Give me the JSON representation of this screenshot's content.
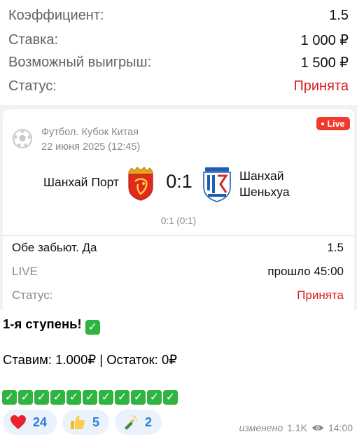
{
  "summary": {
    "rows": [
      {
        "label": "Коэффициент:",
        "value": "1.5"
      },
      {
        "label": "Ставка:",
        "value": "1 000 ₽"
      },
      {
        "label": "Возможный выигрыш:",
        "value": "1 500 ₽"
      },
      {
        "label": "Статус:",
        "value": "Принята"
      }
    ]
  },
  "match": {
    "league": "Футбол. Кубок Китая",
    "datetime": "22 июня 2025 (12:45)",
    "live_badge": "Live",
    "home_team": "Шанхай Порт",
    "away_team_line1": "Шанхай",
    "away_team_line2": "Шеньхуа",
    "score": "0:1",
    "halftime": "0:1 (0:1)",
    "bet_market": "Обе забьют. Да",
    "bet_odds": "1.5",
    "state_label": "LIVE",
    "state_value": "прошло 45:00",
    "status_label": "Статус:",
    "status_value": "Принята"
  },
  "message": {
    "line1": "1-я ступень!",
    "line2": "Ставим: 1.000₽ | Остаток: 0₽",
    "check_count": 11
  },
  "reactions": [
    {
      "emoji": "heart",
      "count": "24"
    },
    {
      "emoji": "thumbs-up",
      "count": "5"
    },
    {
      "emoji": "champagne",
      "count": "2"
    }
  ],
  "meta": {
    "edited": "изменено",
    "views": "1.1K",
    "time": "14:00"
  },
  "colors": {
    "accent_red": "#d81e1e",
    "live_red": "#f2392c",
    "reaction_blue": "#2a7dd6",
    "check_green": "#2fb341"
  }
}
